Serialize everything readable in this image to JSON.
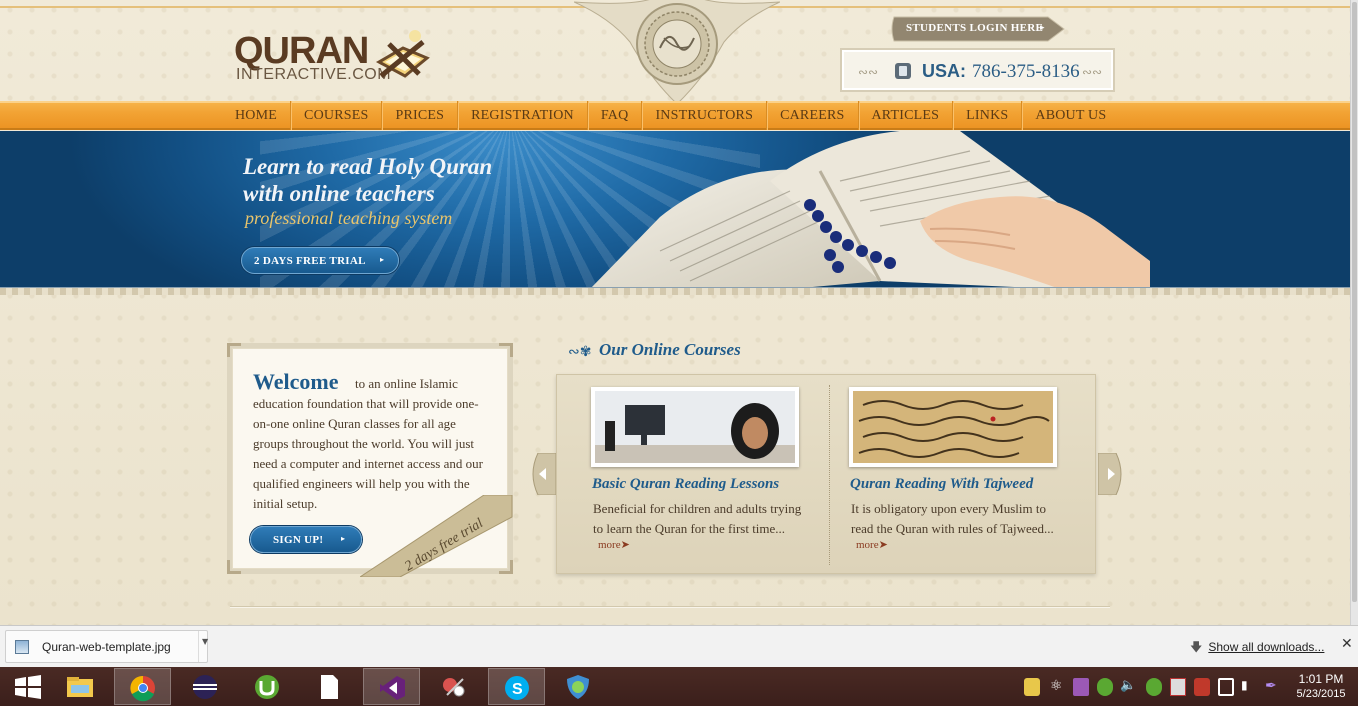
{
  "site": {
    "logo_main": "QURAN",
    "logo_sub": "INTERACTIVE.COM",
    "login_label": "STUDENTS LOGIN HERE",
    "phone_country": "USA:",
    "phone_number": "786-375-8136"
  },
  "nav": {
    "items": [
      "HOME",
      "COURSES",
      "PRICES",
      "REGISTRATION",
      "FAQ",
      "INSTRUCTORS",
      "CAREERS",
      "ARTICLES",
      "LINKS",
      "ABOUT US"
    ]
  },
  "hero": {
    "line1": "Learn to read Holy Quran",
    "line2": "with online teachers",
    "tagline": "professional teaching system",
    "cta_label": "2 DAYS FREE TRIAL"
  },
  "welcome": {
    "title": "Welcome",
    "body": "to an online Islamic education foundation that will provide one-on-one online Quran classes for all age groups throughout the world. You will just need a computer and internet access and our qualified engineers will help you with the initial setup.",
    "signup_label": "SIGN UP!",
    "ribbon_text": "2 days free trial"
  },
  "courses": {
    "heading": "Our Online Courses",
    "cards": [
      {
        "title": "Basic Quran Reading Lessons",
        "desc": "Beneficial for children and adults trying to learn the Quran for the first time...",
        "more": "more➤"
      },
      {
        "title": "Quran Reading With Tajweed",
        "desc": "It is obligatory upon every Muslim to read the Quran with rules of Tajweed...",
        "more": "more➤"
      }
    ]
  },
  "downloads": {
    "file_name": "Quran-web-template.jpg",
    "show_all_label": "Show all downloads..."
  },
  "taskbar": {
    "time": "1:01 PM",
    "date": "5/23/2015",
    "apps": [
      "windows-start-icon",
      "file-explorer-icon",
      "chrome-icon",
      "eclipse-icon",
      "utorrent-icon",
      "document-icon",
      "visual-studio-icon",
      "snipping-tool-icon",
      "skype-icon",
      "vpn-shield-icon"
    ]
  },
  "colors": {
    "accent_blue": "#1f5b8b",
    "nav_orange": "#f2a233",
    "page_beige": "#ece6d3",
    "taskbar": "#3b1f1b"
  }
}
